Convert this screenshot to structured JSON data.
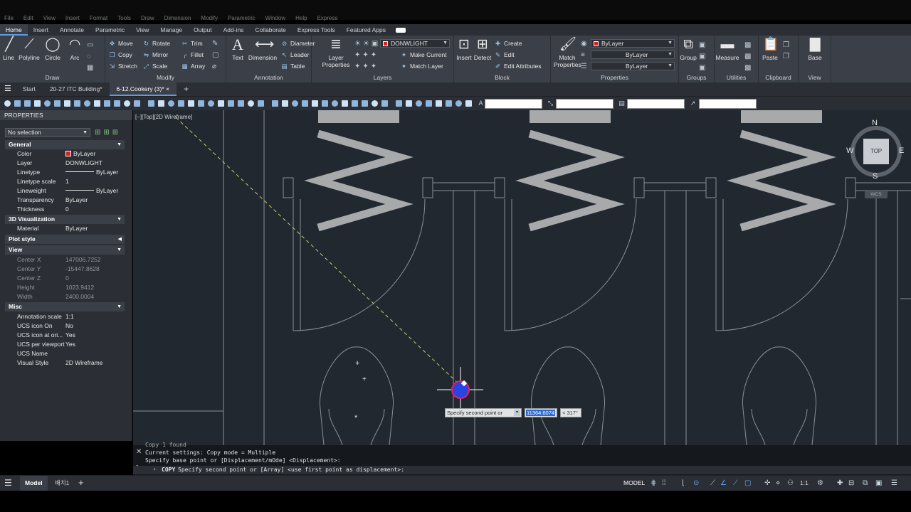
{
  "menubar": [
    "File",
    "Edit",
    "View",
    "Insert",
    "Format",
    "Tools",
    "Draw",
    "Dimension",
    "Modify",
    "Parametric",
    "Window",
    "Help",
    "Express"
  ],
  "ribbon_tabs": [
    "Home",
    "Insert",
    "Annotate",
    "Parametric",
    "View",
    "Manage",
    "Output",
    "Add-ins",
    "Collaborate",
    "Express Tools",
    "Featured Apps"
  ],
  "ribbon": {
    "draw": {
      "title": "Draw",
      "line": "Line",
      "polyline": "Polyline",
      "circle": "Circle",
      "arc": "Arc"
    },
    "modify": {
      "title": "Modify",
      "move": "Move",
      "rotate": "Rotate",
      "trim": "Trim",
      "copy": "Copy",
      "mirror": "Mirror",
      "fillet": "Fillet",
      "stretch": "Stretch",
      "scale": "Scale",
      "array": "Array"
    },
    "annotation": {
      "title": "Annotation",
      "text": "Text",
      "dimension": "Dimension",
      "diameter": "Diameter",
      "leader": "Leader",
      "table": "Table"
    },
    "layers": {
      "title": "Layers",
      "layer_properties": "Layer Properties",
      "current_layer": "DONWLIGHT",
      "make_current": "Make Current",
      "match_layer": "Match Layer"
    },
    "block": {
      "title": "Block",
      "insert": "Insert",
      "detect": "Detect",
      "create": "Create",
      "edit": "Edit",
      "edit_attributes": "Edit Attributes"
    },
    "properties": {
      "title": "Properties",
      "match_properties": "Match Properties",
      "color": "ByLayer",
      "linetype": "ByLayer",
      "lineweight": "ByLayer"
    },
    "groups": {
      "title": "Groups",
      "group": "Group"
    },
    "utilities": {
      "title": "Utilities",
      "measure": "Measure"
    },
    "clipboard": {
      "title": "Clipboard",
      "paste": "Paste"
    },
    "view": {
      "title": "View",
      "base": "Base"
    }
  },
  "doc_tabs": [
    "Start",
    "20-27 ITC Building*",
    "6-12.Cookery (3)*"
  ],
  "palette": {
    "title": "PROPERTIES",
    "selection": "No selection",
    "sections": {
      "general": "General",
      "viz": "3D Visualization",
      "plot": "Plot style",
      "view": "View",
      "misc": "Misc"
    },
    "general": [
      {
        "k": "Color",
        "v": "ByLayer"
      },
      {
        "k": "Layer",
        "v": "DONWLIGHT"
      },
      {
        "k": "Linetype",
        "v": "ByLayer"
      },
      {
        "k": "Linetype scale",
        "v": "1"
      },
      {
        "k": "Lineweight",
        "v": "ByLayer"
      },
      {
        "k": "Transparency",
        "v": "ByLayer"
      },
      {
        "k": "Thickness",
        "v": "0"
      }
    ],
    "viz": [
      {
        "k": "Material",
        "v": "ByLayer"
      }
    ],
    "view": [
      {
        "k": "Center X",
        "v": "147006.7252"
      },
      {
        "k": "Center Y",
        "v": "-15447.8628"
      },
      {
        "k": "Center Z",
        "v": "0"
      },
      {
        "k": "Height",
        "v": "1023.9412"
      },
      {
        "k": "Width",
        "v": "2400.0004"
      }
    ],
    "misc": [
      {
        "k": "Annotation scale",
        "v": "1:1"
      },
      {
        "k": "UCS icon On",
        "v": "No"
      },
      {
        "k": "UCS icon at ori...",
        "v": "Yes"
      },
      {
        "k": "UCS per viewport",
        "v": "Yes"
      },
      {
        "k": "UCS Name",
        "v": ""
      },
      {
        "k": "Visual Style",
        "v": "2D Wireframe"
      }
    ]
  },
  "viewport": {
    "label": "[−][Top][2D Wireframe]",
    "compass": {
      "n": "N",
      "s": "S",
      "e": "E",
      "w": "W",
      "top": "TOP",
      "wcs": "WCS"
    },
    "tooltip": "Specify second point or",
    "distance": "11364.6074",
    "angle": "< 317°"
  },
  "command": {
    "line0": "Copy 1 found",
    "line1": "Current settings:  Copy mode = Multiple",
    "line2": "Specify base point or [Displacement/mOde] <Displacement>:",
    "prompt_cmd": "COPY",
    "prompt": "Specify second point or [Array] <use first point as displacement>:"
  },
  "status": {
    "layout_tabs": [
      "Model",
      "배치1"
    ],
    "model": "MODEL",
    "scale": "1:1"
  }
}
